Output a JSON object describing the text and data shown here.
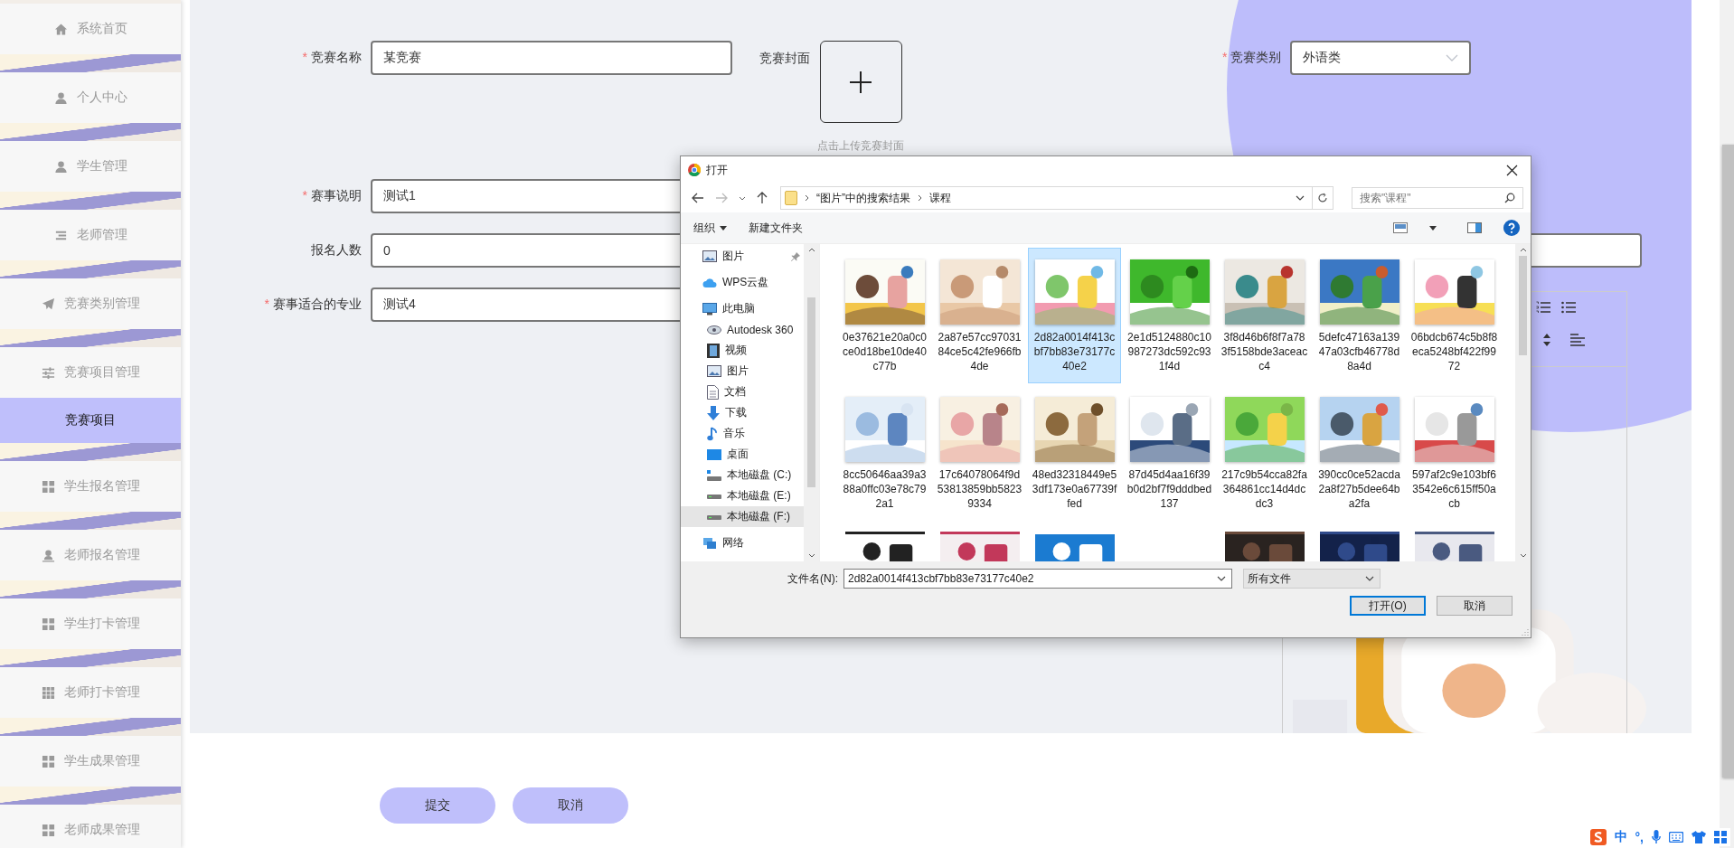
{
  "sidebar": {
    "items": [
      {
        "label": "系统首页",
        "selected": false
      },
      {
        "label": "个人中心",
        "selected": false
      },
      {
        "label": "学生管理",
        "selected": false
      },
      {
        "label": "老师管理",
        "selected": false
      },
      {
        "label": "竞赛类别管理",
        "selected": false
      },
      {
        "label": "竞赛项目管理",
        "selected": false,
        "children": [
          {
            "label": "竞赛项目",
            "selected": true
          }
        ]
      },
      {
        "label": "学生报名管理",
        "selected": false
      },
      {
        "label": "老师报名管理",
        "selected": false
      },
      {
        "label": "学生打卡管理",
        "selected": false
      },
      {
        "label": "老师打卡管理",
        "selected": false
      },
      {
        "label": "学生成果管理",
        "selected": false
      },
      {
        "label": "老师成果管理",
        "selected": false
      }
    ]
  },
  "form": {
    "name": {
      "label": "竞赛名称",
      "required_mark": "*",
      "value": "某竞赛"
    },
    "cover": {
      "label": "竞赛封面",
      "hint": "点击上传竞赛封面"
    },
    "category": {
      "label": "竞赛类别",
      "required_mark": "*",
      "value": "外语类"
    },
    "description": {
      "label": "赛事说明",
      "required_mark": "*",
      "value": "测试1"
    },
    "count": {
      "label": "报名人数",
      "value": "0"
    },
    "major": {
      "label": "赛事适合的专业",
      "required_mark": "*",
      "value": "测试4"
    }
  },
  "buttons": [
    {
      "label": "提交"
    },
    {
      "label": "取消"
    }
  ],
  "dialog": {
    "title": "打开",
    "path": [
      {
        "label": "“图片”中的搜索结果"
      },
      {
        "label": "课程"
      }
    ],
    "search": {
      "placeholder": "搜索\"课程\""
    },
    "toolbar": {
      "organize": "组织",
      "new_folder": "新建文件夹"
    },
    "nav": [
      {
        "label": "图片",
        "pinned": true,
        "selected": false
      },
      {
        "label": "WPS云盘",
        "pinned": false,
        "selected": false
      },
      {
        "label": "此电脑",
        "pinned": false,
        "selected": false,
        "children": [
          {
            "label": "Autodesk 360",
            "selected": false
          },
          {
            "label": "视频",
            "selected": false
          },
          {
            "label": "图片",
            "selected": false
          },
          {
            "label": "文档",
            "selected": false
          },
          {
            "label": "下载",
            "selected": false
          },
          {
            "label": "音乐",
            "selected": false
          },
          {
            "label": "桌面",
            "selected": false
          },
          {
            "label": "本地磁盘 (C:)",
            "selected": false
          },
          {
            "label": "本地磁盘 (E:)",
            "selected": false
          },
          {
            "label": "本地磁盘 (F:)",
            "selected": true
          }
        ]
      },
      {
        "label": "网络",
        "pinned": false,
        "selected": false
      }
    ],
    "files": [
      {
        "name": "0e37621e20a0c0ce0d18be10de40c77b",
        "selected": false
      },
      {
        "name": "2a87e57cc9703184ce5c42fe966fb4de",
        "selected": false
      },
      {
        "name": "2d82a0014f413cbf7bb83e73177c40e2",
        "selected": true
      },
      {
        "name": "2e1d5124880c10987273dc592c931f4d",
        "selected": false
      },
      {
        "name": "3f8d46b6f8f7a783f5158bde3aceacc4",
        "selected": false
      },
      {
        "name": "5defc47163a13947a03cfb46778d8a4d",
        "selected": false
      },
      {
        "name": "06bdcb674c5b8f8eca5248bf422f9972",
        "selected": false
      },
      {
        "name": "8cc50646aa39a388a0ffc03e78c792a1",
        "selected": false
      },
      {
        "name": "17c64078064f9d53813859bb58239334",
        "selected": false
      },
      {
        "name": "48ed32318449e53df173e0a67739ffed",
        "selected": false
      },
      {
        "name": "87d45d4aa16f39b0d2bf7f9dddbed137",
        "selected": false
      },
      {
        "name": "217c9b54cca82fa364861cc14d4dcdc3",
        "selected": false
      },
      {
        "name": "390cc0ce52acda2a8f27b5dee64ba2fa",
        "selected": false
      },
      {
        "name": "597af2c9e103bf63542e6c615ff50acb",
        "selected": false
      }
    ],
    "filename": {
      "label": "文件名(N):",
      "value": "2d82a0014f413cbf7bb83e73177c40e2"
    },
    "filetype": {
      "value": "所有文件"
    },
    "buttons": [
      {
        "label": "打开(O)",
        "default": true
      },
      {
        "label": "取消",
        "default": false
      }
    ]
  },
  "ime_bar": {
    "mode": "中",
    "punctuation": "°,"
  }
}
